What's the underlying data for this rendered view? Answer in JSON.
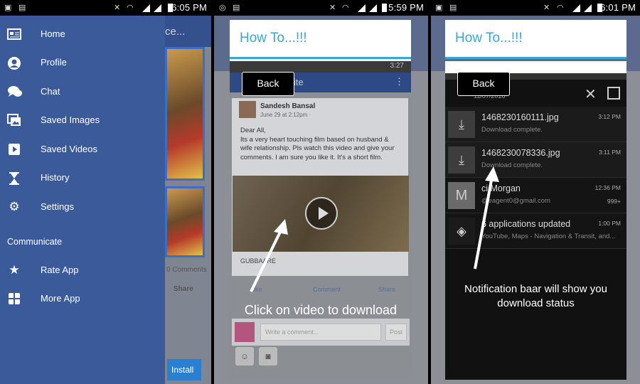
{
  "status_bars": [
    {
      "time": "6:05 PM"
    },
    {
      "time": "5:59 PM"
    },
    {
      "time": "6:01 PM"
    }
  ],
  "drawer": {
    "items": [
      {
        "label": "Home",
        "icon": "home-icon"
      },
      {
        "label": "Profile",
        "icon": "profile-icon"
      },
      {
        "label": "Chat",
        "icon": "chat-icon"
      },
      {
        "label": "Saved Images",
        "icon": "images-icon"
      },
      {
        "label": "Saved Videos",
        "icon": "video-icon"
      },
      {
        "label": "History",
        "icon": "hourglass-icon"
      },
      {
        "label": "Settings",
        "icon": "gear-icon"
      }
    ],
    "section": "Communicate",
    "extra": [
      {
        "label": "Rate App",
        "icon": "star-icon"
      },
      {
        "label": "More App",
        "icon": "grid-icon"
      }
    ]
  },
  "panel1_behind": {
    "title_fragment": "ce...",
    "comments": "0 Comments",
    "share": "Share",
    "install": "Install"
  },
  "how_to": {
    "title": "How To...!!!",
    "back": "Back"
  },
  "panel2": {
    "bar_time": "3:27",
    "bar_fragment": "ite",
    "post_name": "Sandesh Bansal",
    "post_date": "June 29 at 2:12pm · ",
    "post_body": "Dear All,\nIts a very heart touching film based on husband & wife relationship. Pls watch this video and give your comments. I am sure you like it. It's a short film.",
    "video_title": "GUBBAARE",
    "actions": {
      "like": "Like",
      "comment": "Comment",
      "share": "Share"
    },
    "comment_placeholder": "Write a comment...",
    "post_button": "Post",
    "caption": "Click on video to download"
  },
  "panel3": {
    "date_header": "11/07/2016",
    "notifications": [
      {
        "title": "1468230160111.jpg",
        "sub": "Download complete.",
        "time": "3:12 PM",
        "icon": "download-icon",
        "extra": ""
      },
      {
        "title": "1468230078336.jpg",
        "sub": "Download complete.",
        "time": "3:11 PM",
        "icon": "download-icon",
        "extra": ""
      },
      {
        "title": "ci Morgan",
        "sub": "@eagent0@gmail.com",
        "time": "12:36 PM",
        "icon": "M",
        "extra": "999+"
      },
      {
        "title": "6 applications updated",
        "sub": "YouTube, Maps - Navigation & Transit, and...",
        "time": "1:00 PM",
        "icon": "play-store-icon",
        "extra": ""
      }
    ],
    "caption_line1": "Notification baar will show you",
    "caption_line2": "download status"
  }
}
